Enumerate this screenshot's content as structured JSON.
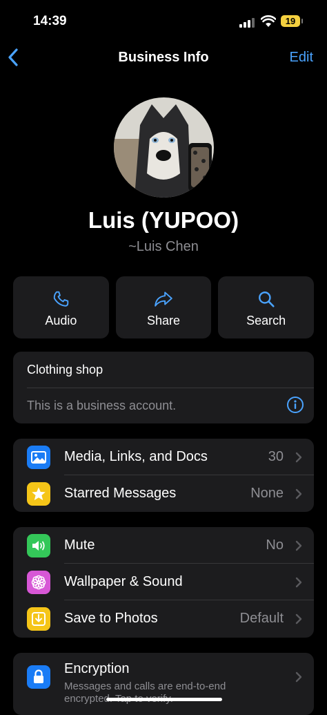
{
  "status": {
    "time": "14:39",
    "battery": "19"
  },
  "nav": {
    "title": "Business Info",
    "edit": "Edit"
  },
  "profile": {
    "name": "Luis (YUPOO)",
    "subname": "~Luis Chen"
  },
  "actions": [
    {
      "label": "Audio",
      "icon": "phone-icon"
    },
    {
      "label": "Share",
      "icon": "share-arrow-icon"
    },
    {
      "label": "Search",
      "icon": "search-icon"
    }
  ],
  "business": {
    "category": "Clothing shop",
    "notice": "This is a business account."
  },
  "group1": [
    {
      "label": "Media, Links, and Docs",
      "value": "30",
      "icon": "photo-icon",
      "color": "#1a7cf5"
    },
    {
      "label": "Starred Messages",
      "value": "None",
      "icon": "star-icon",
      "color": "#f5c518"
    }
  ],
  "group2": [
    {
      "label": "Mute",
      "value": "No",
      "icon": "speaker-icon",
      "color": "#34c759"
    },
    {
      "label": "Wallpaper & Sound",
      "value": "",
      "icon": "flower-icon",
      "color": "#d757d6"
    },
    {
      "label": "Save to Photos",
      "value": "Default",
      "icon": "download-icon",
      "color": "#f5c518"
    }
  ],
  "encryption": {
    "title": "Encryption",
    "subtitle": "Messages and calls are end-to-end encrypted. Tap to verify.",
    "icon": "lock-icon",
    "color": "#1a7cf5"
  },
  "colors": {
    "accent": "#4aa3ff",
    "card": "#1c1c1e",
    "secondary_text": "#8e8e93"
  }
}
